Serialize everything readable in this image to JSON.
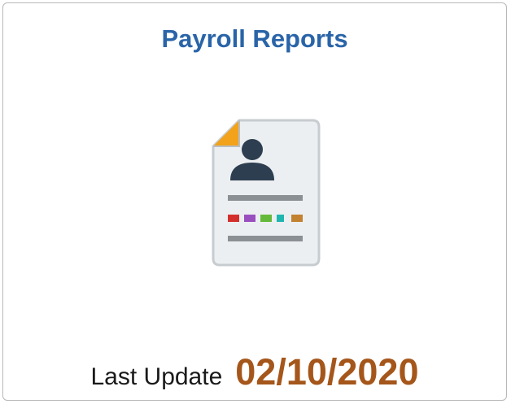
{
  "tile": {
    "title": "Payroll Reports",
    "icon": "payroll-report-document-icon",
    "last_update_label": "Last Update",
    "last_update_value": "02/10/2020"
  },
  "colors": {
    "title": "#2a64a8",
    "date": "#a5561a",
    "doc_fold": "#f2a21b",
    "swatches": [
      "#d3302d",
      "#9a4fbf",
      "#64b93a",
      "#1fb6b0",
      "#c2822f"
    ]
  }
}
